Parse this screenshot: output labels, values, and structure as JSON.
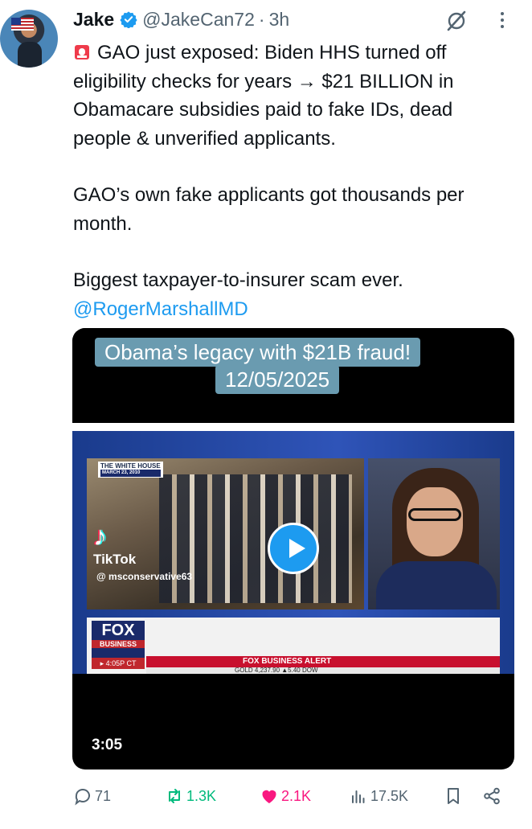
{
  "author": {
    "name": "Jake",
    "handle": "@JakeCan72",
    "separator": "·",
    "time": "3h"
  },
  "tweet": {
    "line1": "GAO just exposed: Biden HHS turned off eligibility checks for years → $21 BILLION in Obamacare subsidies paid to fake IDs, dead people & unverified applicants.",
    "line2": "GAO’s own fake applicants got thousands per month.",
    "line3": "Biggest taxpayer-to-insurer scam ever.",
    "mention": "@RogerMarshallMD"
  },
  "video": {
    "caption_line1": "Obama’s legacy with $21B fraud!",
    "caption_line2": "12/05/2025",
    "whitehouse_tag": "THE WHITE HOUSE",
    "whitehouse_date": "MARCH 23, 2010",
    "tiktok_brand": "TikTok",
    "tiktok_user": "@ msconservative63",
    "network_logo": "FOX",
    "network_sub": "BUSINESS",
    "network_time": "▸ 4:05P CT",
    "alert_text": "FOX BUSINESS ALERT",
    "ticker_text": "GOLD   4,237.90  ▲5.40          DOW",
    "duration": "3:05"
  },
  "actions": {
    "replies": "71",
    "reposts": "1.3K",
    "likes": "2.1K",
    "views": "17.5K"
  },
  "colors": {
    "accent": "#1d9bf0",
    "repost": "#00ba7c",
    "like": "#f91880",
    "muted": "#536471"
  }
}
